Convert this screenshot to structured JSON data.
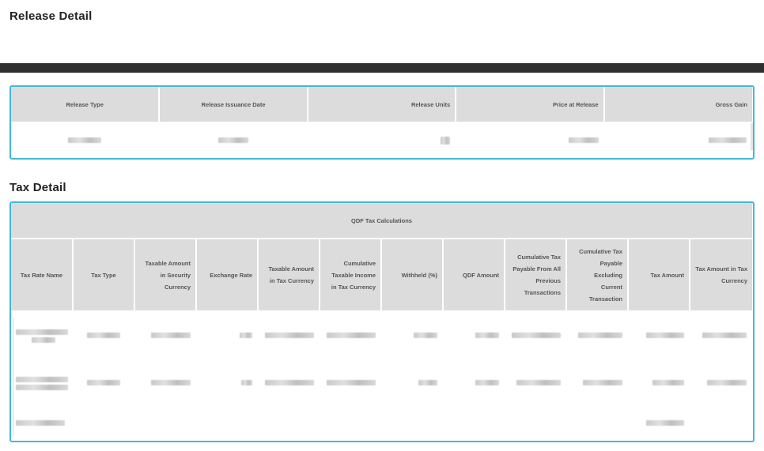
{
  "release": {
    "title": "Release Detail",
    "columns": [
      "Release Type",
      "Release Issuance Date",
      "Release Units",
      "Price at Release",
      "Gross Gain"
    ]
  },
  "tax": {
    "title": "Tax Detail",
    "group_header": "QDF Tax Calculations",
    "columns": [
      "Tax Rate Name",
      "Tax Type",
      "Taxable Amount in Security Currency",
      "Exchange Rate",
      "Taxable Amount in Tax Currency",
      "Cumulative Taxable Income in Tax Currency",
      "Withheld (%)",
      "QDF Amount",
      "Cumulative Tax Payable From All Previous Transactions",
      "Cumulative Tax Payable Excluding Current Transaction",
      "Tax Amount",
      "Tax Amount in Tax Currency"
    ]
  },
  "colors": {
    "accent_border": "#45b8d6",
    "header_bg": "#dcdcdc",
    "dark_bar": "#2f2f2f"
  }
}
